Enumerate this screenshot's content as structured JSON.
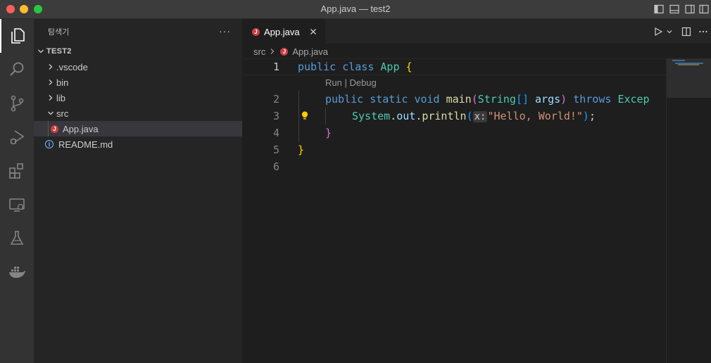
{
  "window": {
    "title": "App.java — test2"
  },
  "activity_bar": {
    "items": [
      {
        "name": "explorer",
        "icon": "files-icon",
        "active": true
      },
      {
        "name": "search",
        "icon": "search-icon"
      },
      {
        "name": "source-control",
        "icon": "source-control-icon"
      },
      {
        "name": "run-debug",
        "icon": "run-debug-icon"
      },
      {
        "name": "extensions",
        "icon": "extensions-icon"
      },
      {
        "name": "remote-explorer",
        "icon": "remote-explorer-icon"
      },
      {
        "name": "testing",
        "icon": "flask-icon"
      },
      {
        "name": "docker",
        "icon": "docker-icon"
      }
    ]
  },
  "sidebar": {
    "title": "탐색기",
    "more": "···",
    "project": "TEST2",
    "tree": [
      {
        "label": ".vscode",
        "type": "folder",
        "expanded": false
      },
      {
        "label": "bin",
        "type": "folder",
        "expanded": false
      },
      {
        "label": "lib",
        "type": "folder",
        "expanded": false
      },
      {
        "label": "src",
        "type": "folder",
        "expanded": true
      },
      {
        "label": "App.java",
        "type": "java-file",
        "selected": true
      },
      {
        "label": "README.md",
        "type": "info-file"
      }
    ]
  },
  "editor": {
    "tab": {
      "label": "App.java",
      "icon_letter": "J"
    },
    "breadcrumb": {
      "folder": "src",
      "file": "App.java"
    },
    "line_numbers": [
      "1",
      "2",
      "3",
      "4",
      "5",
      "6"
    ],
    "codelens": "Run | Debug",
    "code": {
      "l1": {
        "kw1": "public",
        "kw2": "class",
        "name": "App",
        "brace": "{"
      },
      "l2": {
        "kw1": "public",
        "kw2": "static",
        "kw3": "void",
        "fn": "main",
        "p1": "(",
        "type": "String",
        "arr": "[]",
        "var": "args",
        "p2": ")",
        "kw4": "throws",
        "exc": "Excep"
      },
      "l3": {
        "cls": "System",
        "dot1": ".",
        "field": "out",
        "dot2": ".",
        "fn": "println",
        "p1": "(",
        "hint": "x:",
        "str": "\"Hello, World!\"",
        "p2": ")",
        "semi": ";"
      },
      "l4": {
        "brace": "}"
      },
      "l5": {
        "brace": "}"
      }
    }
  },
  "colors": {
    "accent_java": "#cc3e44",
    "keyword": "#569cd6",
    "type": "#4ec9b0",
    "function": "#dcdcaa",
    "variable": "#9cdcfe",
    "string": "#ce9178"
  }
}
